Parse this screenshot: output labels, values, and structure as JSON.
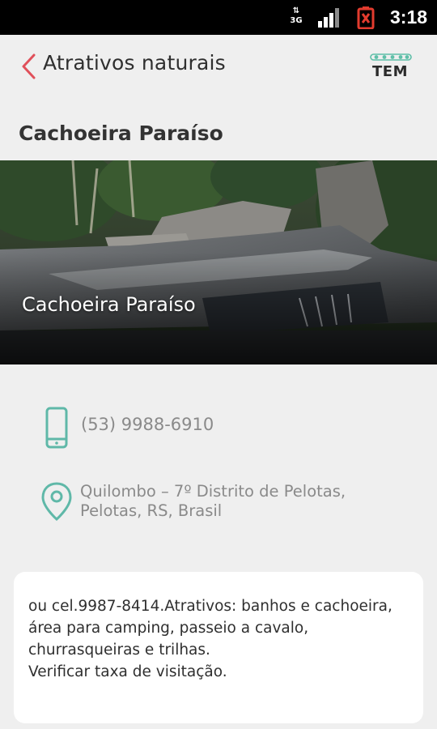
{
  "status_bar": {
    "network_up": "⇅",
    "network_label": "3G",
    "time": "3:18",
    "icons": [
      "network-3g-icon",
      "signal-strength-icon",
      "battery-warning-icon"
    ]
  },
  "header": {
    "title": "Atrativos naturais",
    "logo_text": "TEM",
    "back_icon": "chevron-left-icon",
    "accent_color": "#e0505a",
    "logo_color": "#5fbfa8"
  },
  "place": {
    "title": "Cachoeira Paraíso",
    "image_caption": "Cachoeira Paraíso"
  },
  "contact": {
    "phone": "(53) 9988-6910",
    "address": "Quilombo – 7º Distrito de Pelotas, Pelotas, RS, Brasil",
    "icon_color": "#5fb8a8"
  },
  "description": {
    "text": "ou cel.9987-8414.Atrativos: banhos e cachoeira, área para camping, passeio a cavalo, churrasqueiras e trilhas.\nVerificar taxa de visitação."
  }
}
